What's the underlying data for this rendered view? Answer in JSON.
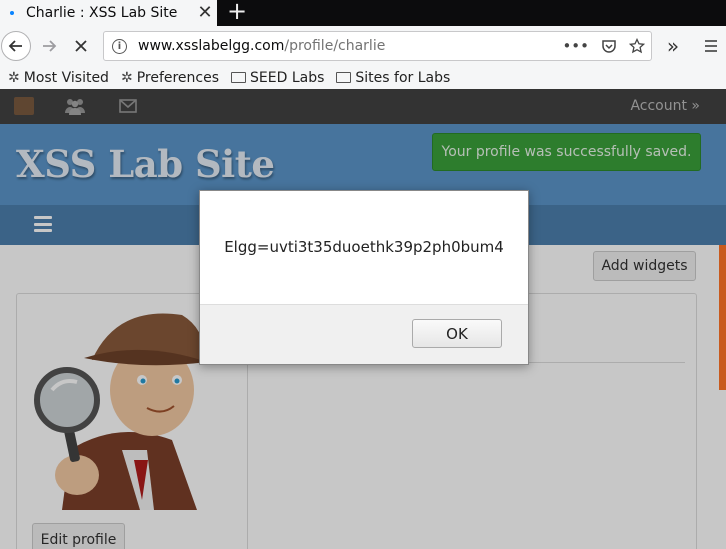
{
  "browser": {
    "tab_title": "Charlie : XSS Lab Site",
    "tab_close": "✕",
    "new_tab": "+",
    "url_host": "www.xsslabelgg.com",
    "url_path": "/profile/charlie",
    "bookmarks": [
      "Most Visited",
      "Preferences",
      "SEED Labs",
      "Sites for Labs"
    ]
  },
  "elgg": {
    "account_label": "Account »",
    "site_title": "XSS Lab Site",
    "success_message": "Your profile was successfully saved.",
    "add_widgets_label": "Add widgets",
    "edit_profile_label": "Edit profile"
  },
  "alert": {
    "message": "Elgg=uvti3t35duoethk39p2ph0bum4",
    "ok_label": "OK"
  },
  "colors": {
    "topbar": "#424242",
    "header": "#5b95c9",
    "subnav": "#4c7fae",
    "success": "#3aa13a"
  }
}
